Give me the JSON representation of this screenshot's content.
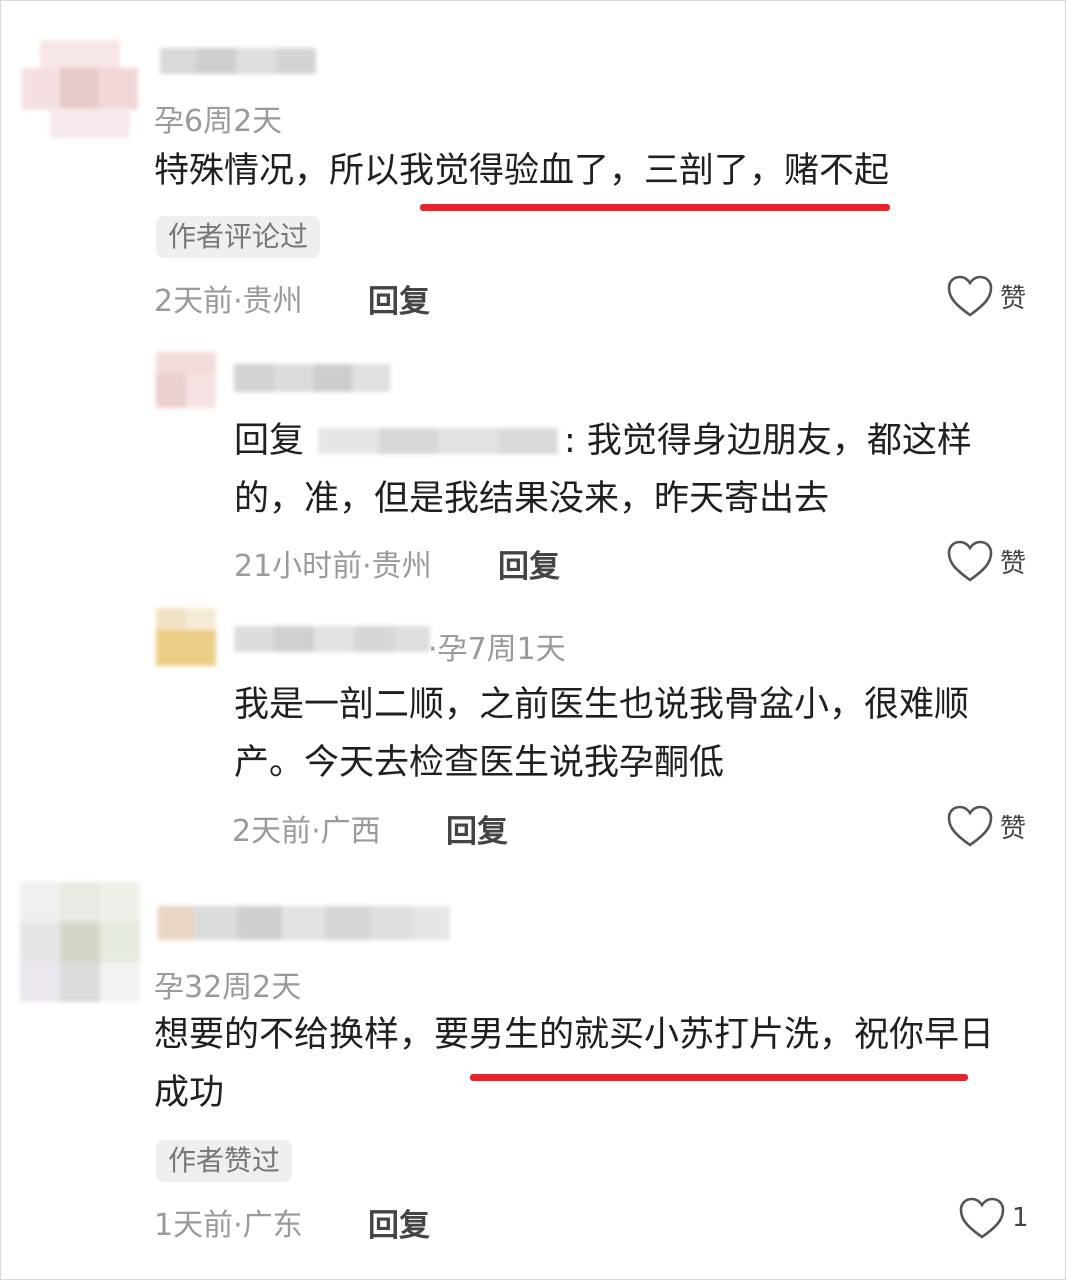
{
  "comments": [
    {
      "badge": "孕6周2天",
      "text": "特殊情况，所以我觉得验血了，三剖了，赌不起",
      "tag": "作者评论过",
      "time_location": "2天前·贵州",
      "reply_label": "回复",
      "like_label": "赞"
    },
    {
      "reply_prefix": "回复",
      "text": ": 我觉得身边朋友，都这样的，准，但是我结果没来，昨天寄出去",
      "time_location": "21小时前·贵州",
      "reply_label": "回复",
      "like_label": "赞"
    },
    {
      "badge": "·孕7周1天",
      "text": "我是一剖二顺，之前医生也说我骨盆小，很难顺产。今天去检查医生说我孕酮低",
      "time_location": "2天前·广西",
      "reply_label": "回复",
      "like_label": "赞"
    },
    {
      "badge": "孕32周2天",
      "text": "想要的不给换样，要男生的就买小苏打片洗，祝你早日成功",
      "tag": "作者赞过",
      "time_location": "1天前·广东",
      "reply_label": "回复",
      "like_label": "1"
    }
  ],
  "colors": {
    "underline": "#e8232a",
    "meta_text": "#9a9a9a",
    "tag_bg": "#efefef"
  }
}
